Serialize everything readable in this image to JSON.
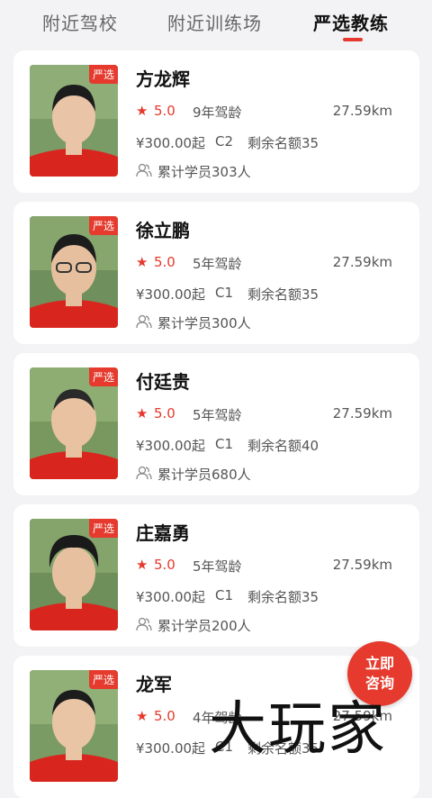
{
  "tabs": [
    {
      "label": "附近驾校"
    },
    {
      "label": "附近训练场"
    },
    {
      "label": "严选教练"
    }
  ],
  "badge_label": "严选",
  "coaches": [
    {
      "name": "方龙辉",
      "rating": "5.0",
      "years": "9年驾龄",
      "distance": "27.59km",
      "price": "¥300.00起",
      "license": "C2",
      "remaining": "剩余名额35",
      "students": "累计学员303人"
    },
    {
      "name": "徐立鹏",
      "rating": "5.0",
      "years": "5年驾龄",
      "distance": "27.59km",
      "price": "¥300.00起",
      "license": "C1",
      "remaining": "剩余名额35",
      "students": "累计学员300人"
    },
    {
      "name": "付廷贵",
      "rating": "5.0",
      "years": "5年驾龄",
      "distance": "27.59km",
      "price": "¥300.00起",
      "license": "C1",
      "remaining": "剩余名额40",
      "students": "累计学员680人"
    },
    {
      "name": "庄嘉勇",
      "rating": "5.0",
      "years": "5年驾龄",
      "distance": "27.59km",
      "price": "¥300.00起",
      "license": "C1",
      "remaining": "剩余名额35",
      "students": "累计学员200人"
    },
    {
      "name": "龙军",
      "rating": "5.0",
      "years": "4年驾龄",
      "distance": "27.59km",
      "price": "¥300.00起",
      "license": "C1",
      "remaining": "剩余名额35",
      "students": ""
    }
  ],
  "consult": {
    "line1": "立即",
    "line2": "咨询"
  },
  "watermark": "大玩家",
  "colors": {
    "accent": "#e53a2d",
    "background": "#f3f3f5"
  },
  "icons": {
    "star": "star-icon",
    "students": "user-group-icon"
  }
}
